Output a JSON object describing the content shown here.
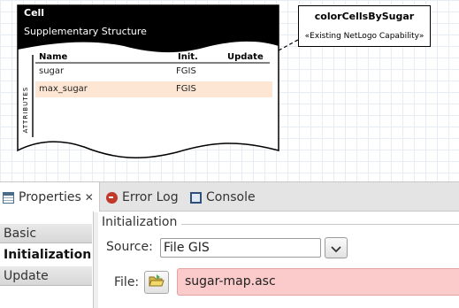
{
  "diagram": {
    "cell_box": {
      "title": "Cell",
      "stereotype": "Supplementary Structure",
      "columns": [
        "Name",
        "Init.",
        "Update"
      ],
      "rows": [
        {
          "name": "sugar",
          "init": "FGIS",
          "update": ""
        },
        {
          "name": "max_sugar",
          "init": "FGIS",
          "update": ""
        }
      ],
      "section_label": "ATTRIBUTES"
    },
    "capability_box": {
      "title": "colorCellsBySugar",
      "stereotype": "«Existing NetLogo Capability»"
    }
  },
  "tabs": [
    {
      "label": "Properties",
      "icon": "properties-icon",
      "active": true,
      "close": "✕"
    },
    {
      "label": "Error Log",
      "icon": "error-log-icon"
    },
    {
      "label": "Console",
      "icon": "console-icon"
    }
  ],
  "sidebar": {
    "items": [
      {
        "label": "Basic"
      },
      {
        "label": "Initialization",
        "selected": true
      },
      {
        "label": "Update"
      }
    ]
  },
  "content": {
    "section_title": "Initialization",
    "source": {
      "label": "Source:",
      "value": "File GIS"
    },
    "file": {
      "label": "File:",
      "value": "sugar-map.asc"
    }
  },
  "colors": {
    "selected_row": "#fde7d4",
    "invalid_field": "#fbcaca",
    "header_black": "#000000"
  }
}
